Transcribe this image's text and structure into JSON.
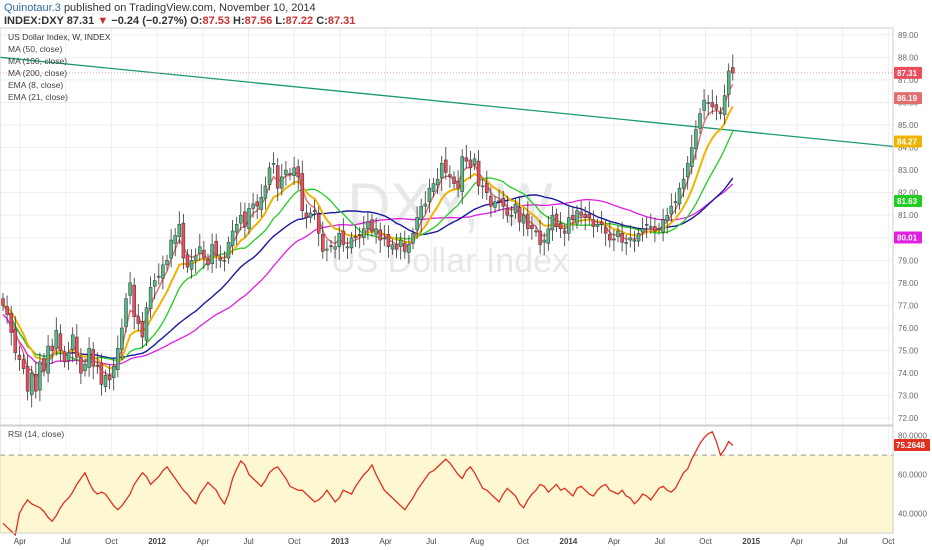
{
  "header": {
    "author": "Quinotaur.3",
    "published": "published on TradingView.com, November 10, 2014",
    "symbol": "INDEX:DXY",
    "last": "87.31",
    "change": "−0.24 (−0.27%)",
    "o_label": "O:",
    "o": "87.53",
    "h_label": "H:",
    "h": "87.56",
    "l_label": "L:",
    "l": "87.22",
    "c_label": "C:",
    "c": "87.31"
  },
  "legend": {
    "title": "US Dollar Index, W, INDEX",
    "items": [
      "MA (50, close)",
      "MA (100, close)",
      "MA (200, close)",
      "EMA (8, close)",
      "EMA (21, close)"
    ]
  },
  "watermark": {
    "symbol": "DXY, W",
    "name": "US Dollar Index"
  },
  "colors": {
    "up": "#53b987",
    "down": "#eb4d5c",
    "ma50": "#22cc22",
    "ma100": "#1a1aa0",
    "ma200": "#e020e0",
    "ema8": "#e07070",
    "ema21": "#f0b400",
    "trend": "#1a9a70",
    "rsi": "#e03020",
    "rsi_band": "#fdf8d2"
  },
  "price_axis": {
    "ticks": [
      "89.00",
      "88.00",
      "87.00",
      "86.00",
      "85.00",
      "84.00",
      "83.00",
      "82.00",
      "81.00",
      "80.00",
      "79.00",
      "78.00",
      "77.00",
      "76.00",
      "75.00",
      "74.00",
      "73.00",
      "72.00"
    ],
    "badges": [
      {
        "value": 87.31,
        "label": "87.31",
        "color": "#eb4d5c"
      },
      {
        "value": 86.19,
        "label": "86.19",
        "color": "#e07070"
      },
      {
        "value": 84.27,
        "label": "84.27",
        "color": "#f0b400"
      },
      {
        "value": 81.63,
        "label": "81.63",
        "color": "#22cc22"
      },
      {
        "value": 80.01,
        "label": "80.01",
        "color": "#e020e0"
      }
    ]
  },
  "rsi_panel": {
    "title": "RSI (14, close)",
    "ticks": [
      "80.0000",
      "60.0000",
      "40.0000"
    ],
    "badge": {
      "value": 75.2648,
      "label": "75.2648"
    }
  },
  "time_axis": {
    "labels": [
      "Apr",
      "Jul",
      "Oct",
      "2012",
      "Apr",
      "Jul",
      "Oct",
      "2013",
      "Apr",
      "Jul",
      "Aug",
      "Oct",
      "2014",
      "Apr",
      "Jul",
      "Oct",
      "2015",
      "Apr",
      "Jul",
      "Oct"
    ],
    "bold_labels": [
      "2012",
      "2013",
      "2014",
      "2015"
    ]
  },
  "chart_data": {
    "type": "candlestick",
    "title": "US Dollar Index, W, INDEX",
    "ylim": [
      71.7,
      89.3
    ],
    "rsi_ylim": [
      30,
      85
    ],
    "closes": [
      77.0,
      76.6,
      75.8,
      74.9,
      74.6,
      74.2,
      73.2,
      74.0,
      73.2,
      74.5,
      74.1,
      75.2,
      75.0,
      75.9,
      75.0,
      74.5,
      74.9,
      75.7,
      74.7,
      74.0,
      74.4,
      75.1,
      74.3,
      74.3,
      73.5,
      73.9,
      73.7,
      74.3,
      75.1,
      76.0,
      77.3,
      78.0,
      76.5,
      76.2,
      75.6,
      76.9,
      77.8,
      78.1,
      78.3,
      78.8,
      79.0,
      79.9,
      80.1,
      80.6,
      79.1,
      78.7,
      79.0,
      79.2,
      79.6,
      79.1,
      78.8,
      79.7,
      79.2,
      79.0,
      79.0,
      79.8,
      80.3,
      80.6,
      81.0,
      80.5,
      81.3,
      81.5,
      81.4,
      81.8,
      82.3,
      83.1,
      83.3,
      82.2,
      82.7,
      83.0,
      82.8,
      83.1,
      82.7,
      81.2,
      80.9,
      81.1,
      81.2,
      80.2,
      79.4,
      79.5,
      79.6,
      79.6,
      80.2,
      79.7,
      79.6,
      80.0,
      80.0,
      80.1,
      80.4,
      80.7,
      80.3,
      80.4,
      79.9,
      80.0,
      79.6,
      79.7,
      79.5,
      79.9,
      79.4,
      79.7,
      80.2,
      80.9,
      81.4,
      81.5,
      82.2,
      82.4,
      82.6,
      83.3,
      82.9,
      82.7,
      82.4,
      82.2,
      83.6,
      83.4,
      83.1,
      83.5,
      82.3,
      82.3,
      82.0,
      81.4,
      81.6,
      81.6,
      81.4,
      81.0,
      81.0,
      81.5,
      80.7,
      81.0,
      80.4,
      80.4,
      80.3,
      79.7,
      79.9,
      80.4,
      81.0,
      80.5,
      80.4,
      80.2,
      80.9,
      80.8,
      81.2,
      81.0,
      80.9,
      80.9,
      80.5,
      80.6,
      80.6,
      80.2,
      79.9,
      79.9,
      80.3,
      79.8,
      79.8,
      80.0,
      79.9,
      80.2,
      80.4,
      80.6,
      80.5,
      80.3,
      80.4,
      80.8,
      81.0,
      81.4,
      81.6,
      82.2,
      82.6,
      83.3,
      84.0,
      84.8,
      85.5,
      86.1,
      86.0,
      85.8,
      85.7,
      85.5,
      86.3,
      87.4,
      87.3
    ],
    "rsi": [
      35,
      33,
      31,
      29,
      40,
      44,
      47,
      45,
      44,
      43,
      41,
      38,
      36,
      39,
      43,
      46,
      48,
      51,
      55,
      58,
      61,
      56,
      52,
      50,
      51,
      50,
      47,
      44,
      42,
      44,
      47,
      50,
      55,
      58,
      61,
      59,
      55,
      57,
      59,
      62,
      64,
      61,
      58,
      55,
      52,
      50,
      47,
      45,
      50,
      53,
      56,
      54,
      52,
      48,
      45,
      50,
      58,
      63,
      67,
      65,
      60,
      58,
      56,
      54,
      57,
      61,
      63,
      64,
      61,
      58,
      54,
      53,
      52,
      52,
      50,
      48,
      46,
      47,
      49,
      52,
      49,
      46,
      48,
      52,
      51,
      50,
      54,
      57,
      60,
      62,
      65,
      60,
      56,
      52,
      50,
      48,
      46,
      44,
      42,
      45,
      48,
      52,
      55,
      58,
      61,
      62,
      64,
      66,
      68,
      66,
      63,
      60,
      58,
      62,
      64,
      61,
      57,
      53,
      52,
      50,
      48,
      46,
      50,
      53,
      51,
      49,
      45,
      43,
      47,
      50,
      52,
      55,
      54,
      51,
      53,
      55,
      52,
      53,
      51,
      49,
      53,
      54,
      52,
      50,
      49,
      52,
      54,
      55,
      52,
      51,
      50,
      52,
      49,
      48,
      45,
      47,
      50,
      49,
      47,
      50,
      53,
      54,
      52,
      51,
      53,
      57,
      61,
      63,
      68,
      72,
      76,
      79,
      81,
      82,
      77,
      70,
      73,
      77,
      75
    ]
  }
}
